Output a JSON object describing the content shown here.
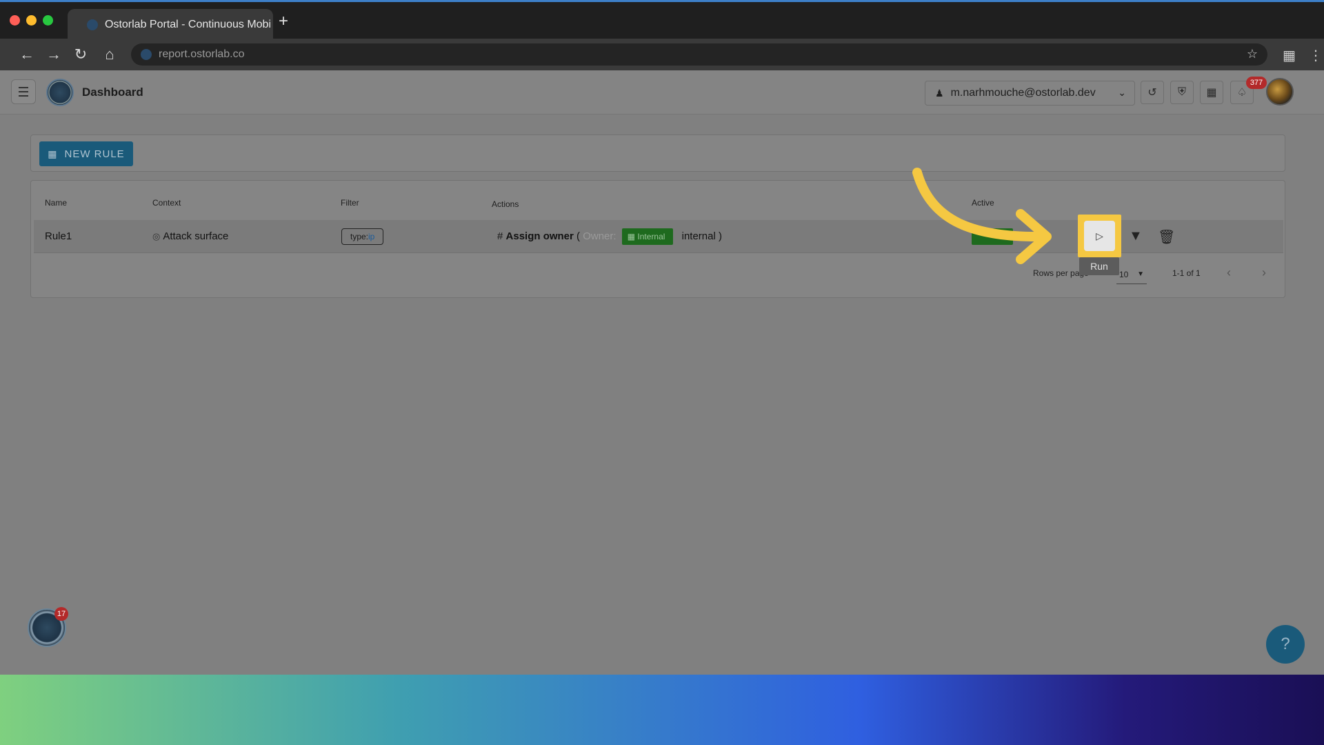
{
  "browser": {
    "tab_title": "Ostorlab Portal - Continuous Mobi",
    "new_tab_label": "+",
    "url": "report.ostorlab.co"
  },
  "header": {
    "title": "Dashboard",
    "org_email": "m.narhmouche@ostorlab.dev",
    "notification_count": "377"
  },
  "toolbar": {
    "new_rule_label": "NEW RULE"
  },
  "table": {
    "columns": [
      "Name",
      "Context",
      "Filter",
      "Actions",
      "Active"
    ],
    "rows": [
      {
        "name": "Rule1",
        "context": "Attack surface",
        "filter_key": "type:",
        "filter_value": "ip",
        "action_name": "Assign owner",
        "action_open": "(",
        "owner_label": "Owner:",
        "owner_chip": "Internal",
        "owner_value": "internal",
        "action_close": ")"
      }
    ]
  },
  "row_actions": {
    "run_tooltip": "Run"
  },
  "pagination": {
    "rows_per_page_label": "Rows per page",
    "rows_per_page_value": "10",
    "range": "1-1 of 1"
  },
  "widgets": {
    "fab_badge": "17",
    "help_label": "?"
  },
  "colors": {
    "brand": "#1a5a7a",
    "active_green": "#1e6a1e",
    "highlight": "#f5c842",
    "notification_red": "#b32a2a"
  }
}
